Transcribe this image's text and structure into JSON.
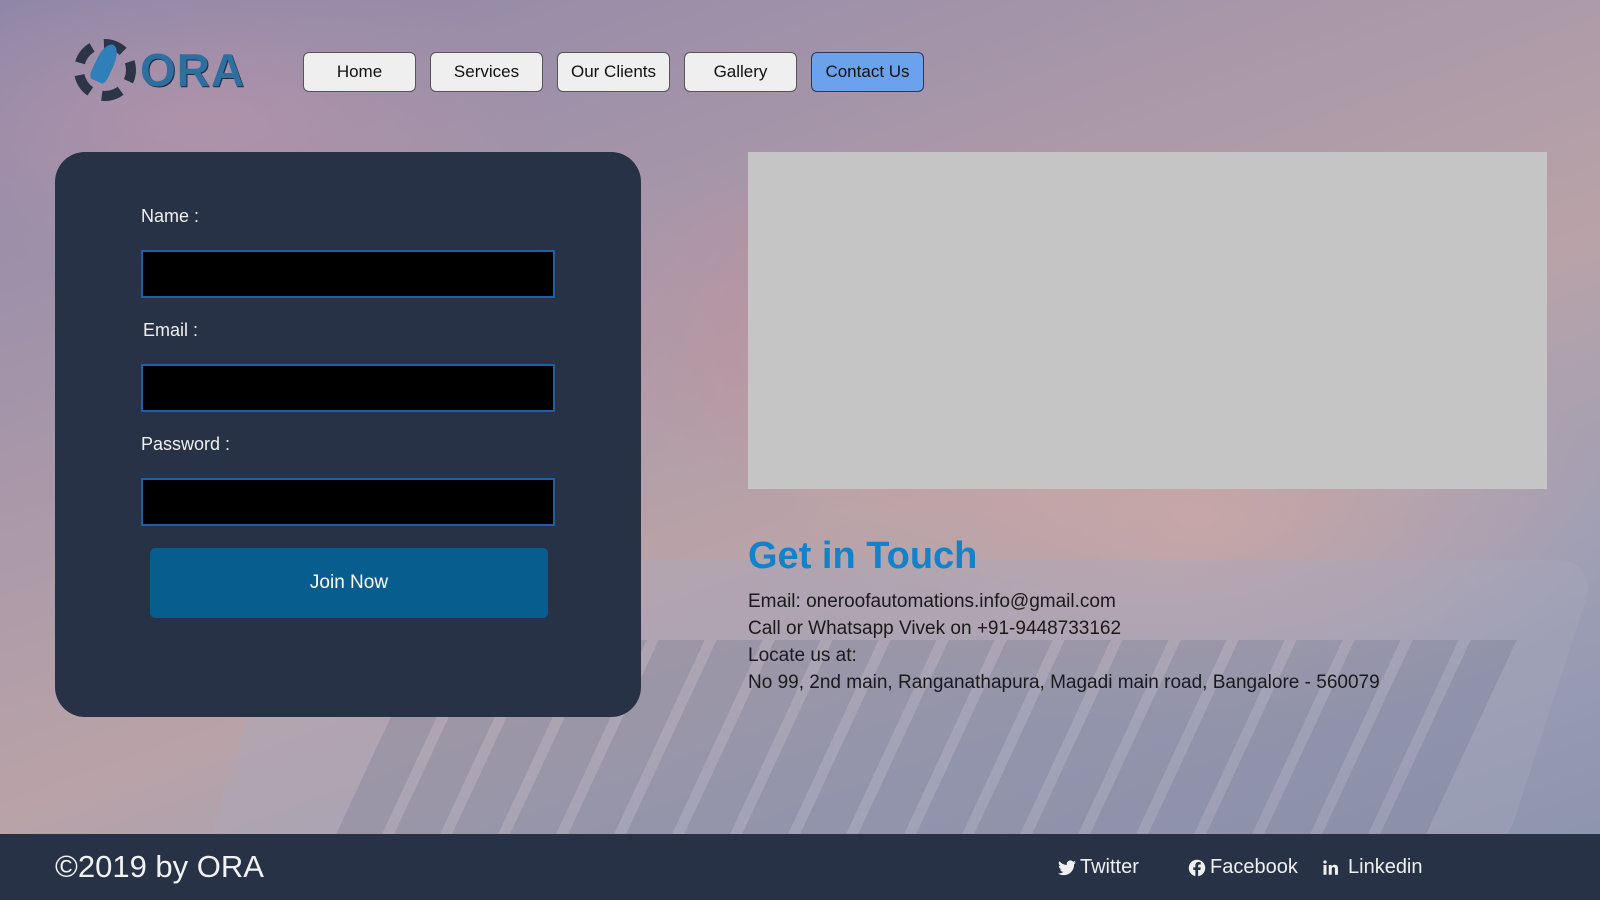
{
  "header": {
    "logo_text": "ORA",
    "nav": [
      {
        "label": "Home"
      },
      {
        "label": "Services"
      },
      {
        "label": "Our Clients"
      },
      {
        "label": "Gallery"
      },
      {
        "label": "Contact Us",
        "active": true
      }
    ]
  },
  "form": {
    "name_label": "Name :",
    "email_label": "Email :",
    "password_label": "Password :",
    "name_value": "",
    "email_value": "",
    "password_value": "",
    "submit_label": "Join Now"
  },
  "contact": {
    "title": "Get in Touch",
    "email_line": "Email: oneroofautomations.info@gmail.com",
    "phone_line": "Call or Whatsapp Vivek on +91-9448733162",
    "locate_line": "Locate us at:",
    "address_line": "No 99, 2nd main, Ranganathapura, Magadi main road, Bangalore - 560079"
  },
  "footer": {
    "copyright": "©2019 by ORA",
    "social": [
      {
        "label": "Twitter",
        "icon": "twitter-icon"
      },
      {
        "label": "Facebook",
        "icon": "facebook-icon"
      },
      {
        "label": "Linkedin",
        "icon": "linkedin-icon"
      }
    ]
  },
  "colors": {
    "card_bg": "#283246",
    "footer_bg": "#283246",
    "accent_blue": "#1283c9",
    "button_blue": "#075e8e",
    "active_nav": "#6aa2ee",
    "map_placeholder": "#c5c5c5"
  }
}
